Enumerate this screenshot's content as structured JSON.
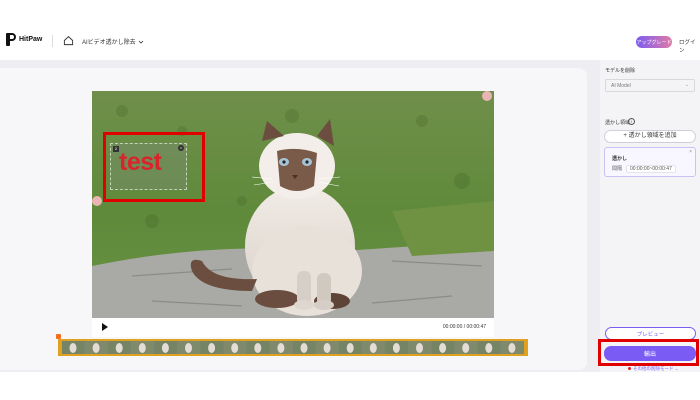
{
  "header": {
    "logo_text": "HitPaw",
    "tool_dropdown_label": "AIビデオ透かし除去",
    "upgrade_label": "アップグレード",
    "login_label": "ログイン"
  },
  "player": {
    "timecode": "00:00:00 / 00:00:47",
    "watermark": {
      "index": "2",
      "text": "test"
    }
  },
  "side": {
    "model_section_label": "モデルを削除",
    "model_value": "AI Model",
    "region_section_label": "透かし領域",
    "add_region_label": "+ 透かし領域を追加",
    "card_title": "透かし",
    "card_duration_label": "間隔",
    "card_time_range": "00:00:00~00:00:47",
    "preview_label": "プレビュー",
    "export_label": "輸出",
    "other_mode_label": "その他の削除モード ⌄"
  },
  "colors": {
    "accent": "#7a5cf5",
    "highlight": "#e00000",
    "watermark_text": "#d8242b"
  }
}
